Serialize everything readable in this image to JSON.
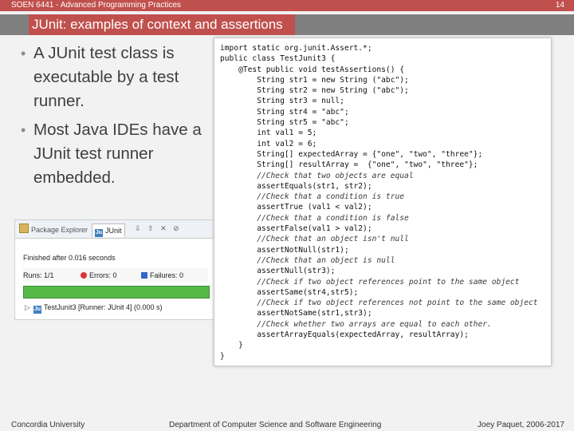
{
  "header": {
    "course": "SOEN 6441 - Advanced Programming Practices",
    "page_number": "14",
    "title": "JUnit: examples of context and assertions"
  },
  "bullets": [
    "A JUnit test class is executable by a test runner.",
    "Most Java IDEs have a JUnit test runner embedded."
  ],
  "ide": {
    "tab_package_explorer": "Package Explorer",
    "tab_junit": "JUnit",
    "toolbar_glyphs": "⇩ ⇧ ✕ ⊘",
    "finished": "Finished after 0.016 seconds",
    "runs_label": "Runs:",
    "runs_value": "1/1",
    "errors_label": "Errors:",
    "errors_value": "0",
    "failures_label": "Failures:",
    "failures_value": "0",
    "progress": 1.0,
    "progress_color": "#55b948",
    "tree_item": "TestJunit3 [Runner: JUnit 4] (0.000 s)"
  },
  "code_lines": [
    "import static org.junit.Assert.*;",
    "public class TestJunit3 {",
    "    @Test public void testAssertions() {",
    "        String str1 = new String (\"abc\");",
    "        String str2 = new String (\"abc\");",
    "        String str3 = null;",
    "        String str4 = \"abc\";",
    "        String str5 = \"abc\";",
    "        int val1 = 5;",
    "        int val2 = 6;",
    "        String[] expectedArray = {\"one\", \"two\", \"three\"};",
    "        String[] resultArray =  {\"one\", \"two\", \"three\"};",
    "        //Check that two objects are equal",
    "        assertEquals(str1, str2);",
    "        //Check that a condition is true",
    "        assertTrue (val1 < val2);",
    "        //Check that a condition is false",
    "        assertFalse(val1 > val2);",
    "        //Check that an object isn't null",
    "        assertNotNull(str1);",
    "        //Check that an object is null",
    "        assertNull(str3);",
    "        //Check if two object references point to the same object",
    "        assertSame(str4,str5);",
    "        //Check if two object references not point to the same object",
    "        assertNotSame(str1,str3);",
    "        //Check whether two arrays are equal to each other.",
    "        assertArrayEquals(expectedArray, resultArray);",
    "    }",
    "}"
  ],
  "footer": {
    "left": "Concordia University",
    "center": "Department of Computer Science and Software Engineering",
    "right": "Joey Paquet, 2006-2017"
  },
  "colors": {
    "accent": "#c0504d",
    "title_band": "#7f7f7f",
    "background": "#f2f2f2"
  }
}
